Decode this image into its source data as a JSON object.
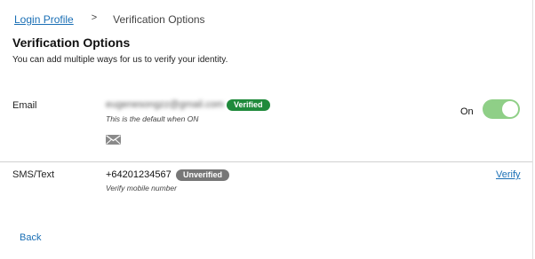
{
  "breadcrumb": {
    "parent": "Login Profile",
    "separator": ">",
    "current": "Verification Options"
  },
  "page": {
    "title": "Verification Options",
    "subtitle": "You can add multiple ways for us to verify your identity."
  },
  "email": {
    "label": "Email",
    "value": "eugenesongzz@gmail.com",
    "status": "Verified",
    "hint": "This is the default when ON",
    "icon": "mail-icon",
    "toggle_label": "On",
    "toggle_on": true,
    "status_color": "#1f8a3b",
    "toggle_color": "#8fcf87"
  },
  "sms": {
    "label": "SMS/Text",
    "value": "+64201234567",
    "status": "Unverified",
    "hint": "Verify mobile number",
    "action": "Verify",
    "status_color": "#777777"
  },
  "footer": {
    "back": "Back"
  },
  "colors": {
    "link": "#1a6fb5"
  }
}
